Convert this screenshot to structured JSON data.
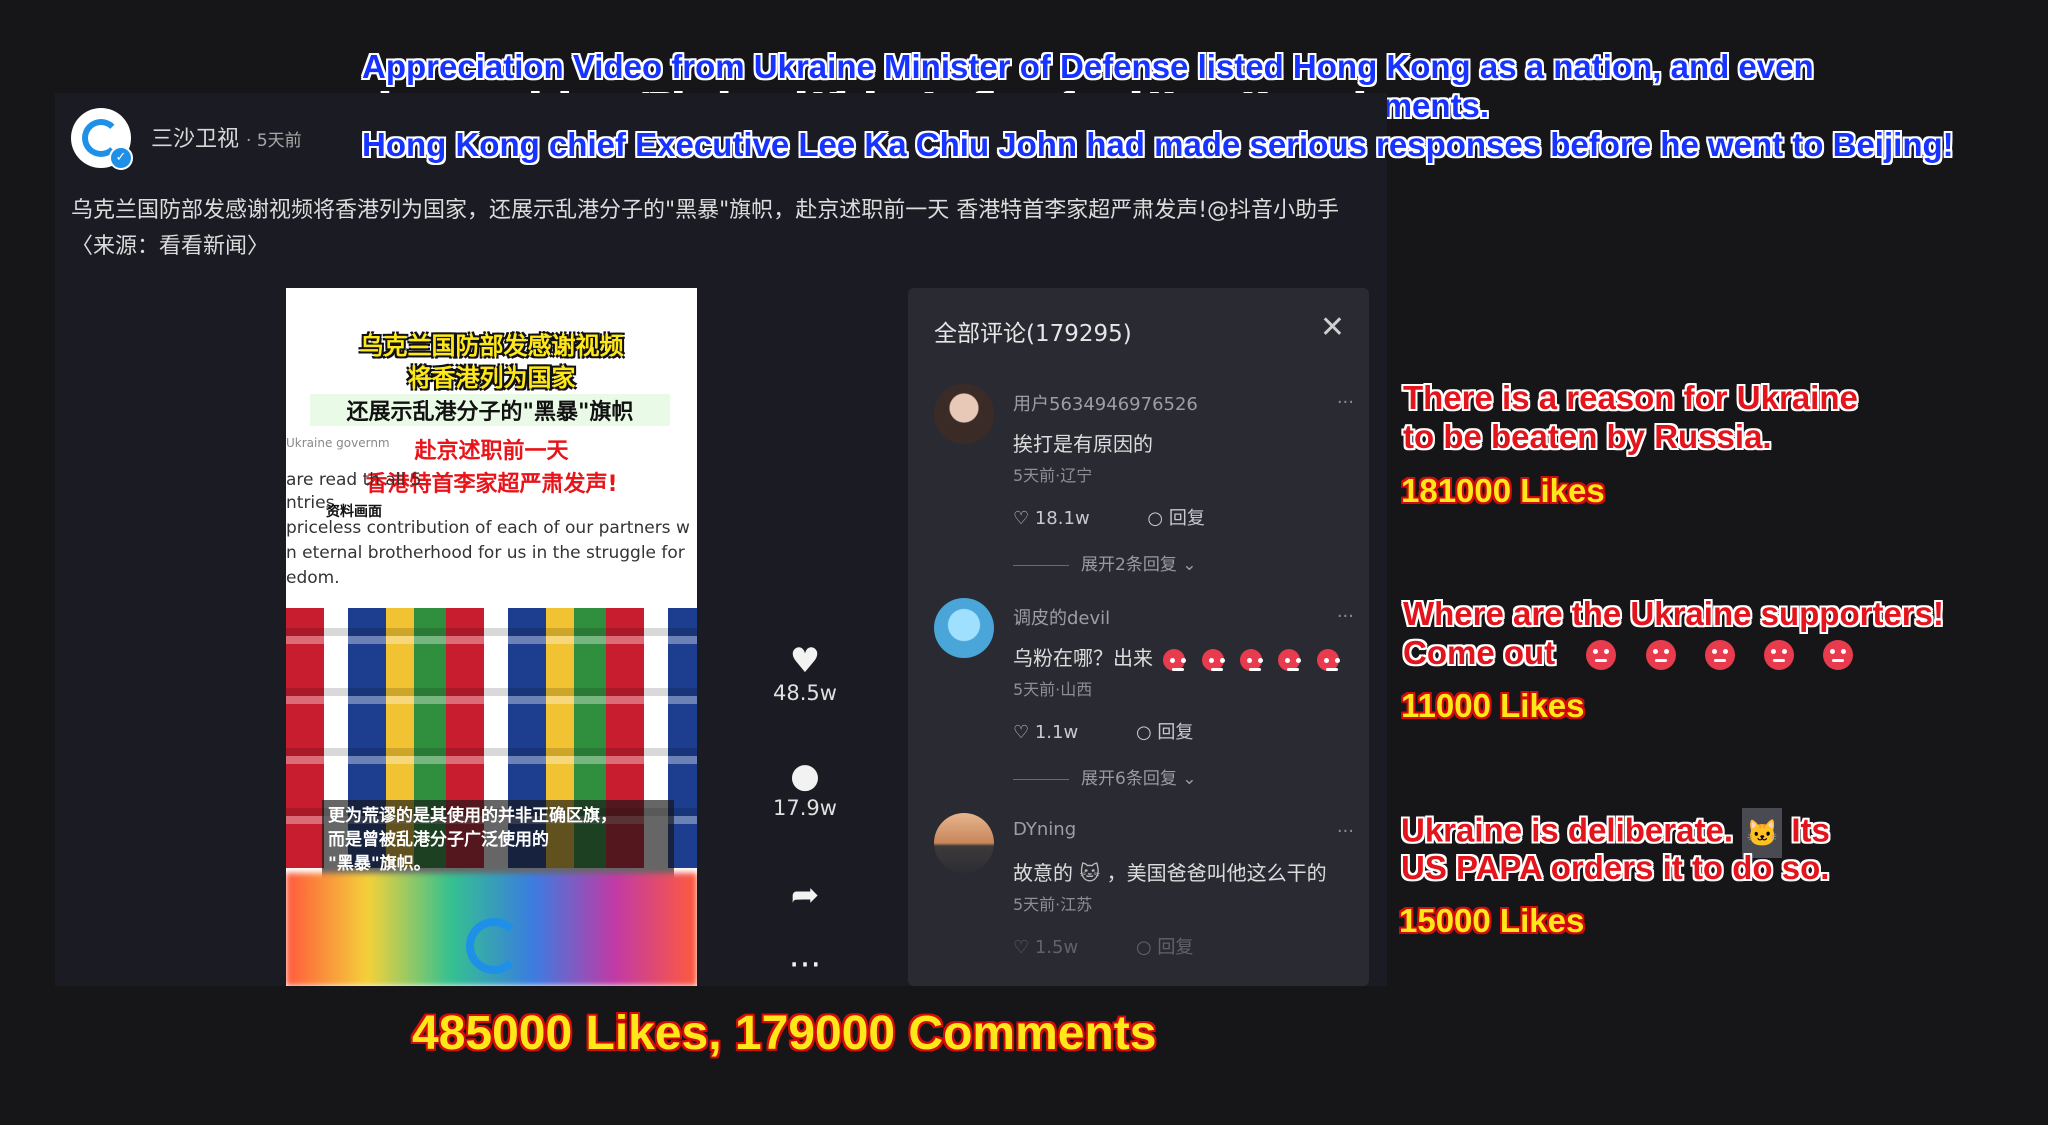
{
  "annotation": {
    "headline_lines": [
      "Appreciation Video from Ukraine Minister of Defense listed Hong Kong as a nation, and even",
      "showcased the 　‘Black and Violent’　 flag of anti Hong Kong elements.",
      "Hong Kong chief Executive Lee Ka Chiu John had made serious responses before he went to Beijing!"
    ],
    "comment_notes": [
      {
        "lines": [
          "There is a reason for Ukraine",
          "to be beaten by Russia."
        ],
        "likes": "181000 Likes"
      },
      {
        "lines": [
          "Where are the Ukraine supporters!",
          "Come out"
        ],
        "likes": "11000 Likes"
      },
      {
        "lines": [
          "Ukraine is deliberate.",
          "Its",
          "US PAPA orders it to do so."
        ],
        "likes": "15000 Likes"
      }
    ],
    "summary": "485000 Likes, 179000 Comments"
  },
  "post": {
    "author": "三沙卫视",
    "time": "· 5天前",
    "description": "乌克兰国防部发感谢视频将香港列为国家，还展示乱港分子的\"黑暴\"旗帜，赴京述职前一天 香港特首李家超严肃发声!@抖音小助手 〈来源：看看新闻〉"
  },
  "video": {
    "title_yellow_1": "乌克兰国防部发感谢视频",
    "title_yellow_2": "将香港列为国家",
    "title_green": "还展示乱港分子的\"黑暴\"旗帜",
    "title_red_1": "赴京述职前一天",
    "title_red_2": "香港特首李家超严肃发声!",
    "source_tag": "资料画面",
    "english_lines": [
      "Ukraine governm",
      "are read                                              th all 5",
      "ntries",
      " priceless contribution of each of our partners w",
      "n eternal brotherhood for us in the struggle for",
      "edom."
    ],
    "caption_lines": [
      "更为荒谬的是其使用的并非正确区旗，",
      "而是曾被乱港分子广泛使用的",
      "\"黑暴\"旗帜。"
    ]
  },
  "actions": {
    "likes": "48.5w",
    "comments": "17.9w"
  },
  "comments": {
    "title": "全部评论(179295)",
    "items": [
      {
        "user": "用户5634946976526",
        "text": "挨打是有原因的",
        "meta": "5天前·辽宁",
        "likes": "18.1w",
        "reply": "回复",
        "expand": "展开2条回复"
      },
      {
        "user": "调皮的devil",
        "text": "乌粉在哪？出来",
        "meta": "5天前·山西",
        "likes": "1.1w",
        "reply": "回复",
        "expand": "展开6条回复"
      },
      {
        "user": "DYning",
        "text": "故意的",
        "text2": "，美国爸爸叫他这么干的",
        "meta": "5天前·江苏",
        "likes": "1.5w",
        "reply": "回复"
      }
    ]
  },
  "colors": {
    "annotation_blue": "#1633ff",
    "annotation_red": "#e3141b",
    "annotation_yellow": "#ffe81a",
    "panel": "#1b1b23",
    "comment_panel": "#2a2a33"
  }
}
